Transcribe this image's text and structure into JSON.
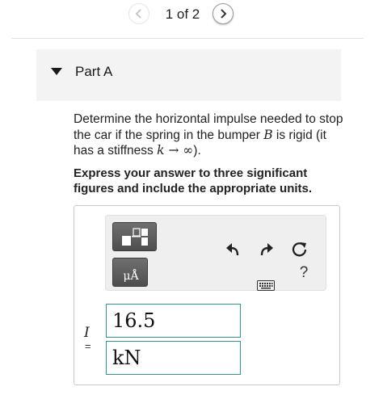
{
  "pager": {
    "text": "1 of 2"
  },
  "part": {
    "label": "Part A"
  },
  "question": {
    "line_start": "Determine the horizontal impulse needed to stop the car if the spring in the bumper ",
    "var_B": "B",
    "line_mid": " is rigid (it has a stiffness ",
    "var_k": "k",
    "arrow_inf": " → ∞",
    "line_end": ")."
  },
  "instruction": "Express your answer to three significant figures and include the appropriate units.",
  "toolbar": {
    "units_button": "μÅ",
    "help": "?",
    "icons": [
      "templates-icon",
      "units-icon",
      "undo-icon",
      "redo-icon",
      "reset-icon",
      "keyboard-icon",
      "help-icon"
    ]
  },
  "answer": {
    "variable": "I",
    "equals": "=",
    "value": "16.5",
    "units": "kN"
  },
  "colors": {
    "field_border": "#2a9a8e",
    "toolbar_button": "#5a5a5a"
  }
}
